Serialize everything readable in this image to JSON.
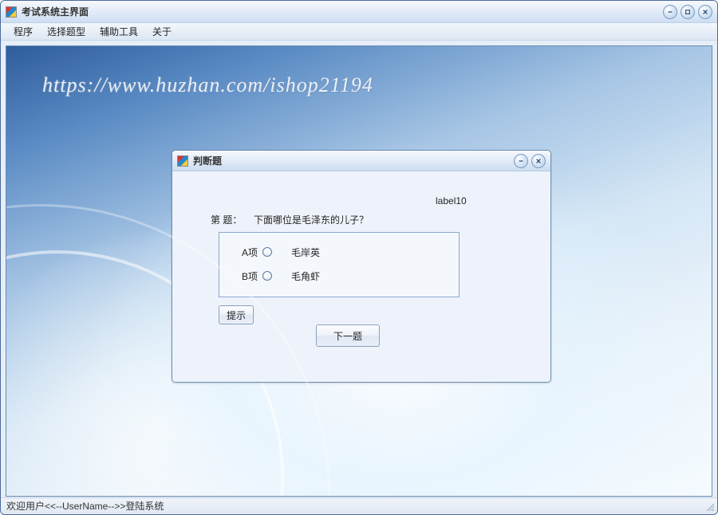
{
  "main": {
    "title": "考试系统主界面",
    "menu": {
      "program": "程序",
      "select_type": "选择题型",
      "tools": "辅助工具",
      "about": "关于"
    },
    "watermark": "https://www.huzhan.com/ishop21194"
  },
  "dialog": {
    "title": "判断题",
    "label10": "label10",
    "question_prefix": "第    题：",
    "question_text": "下面哪位是毛泽东的儿子？",
    "options": {
      "a_label": "A项",
      "a_text": "毛岸英",
      "b_label": "B项",
      "b_text": "毛角虾"
    },
    "hint_btn": "提示",
    "next_btn": "下一题"
  },
  "status": {
    "text": "欢迎用户<<--UserName-->>登陆系统"
  },
  "icons": {
    "minimize": "minimize-icon",
    "maximize": "maximize-icon",
    "close": "close-icon"
  }
}
